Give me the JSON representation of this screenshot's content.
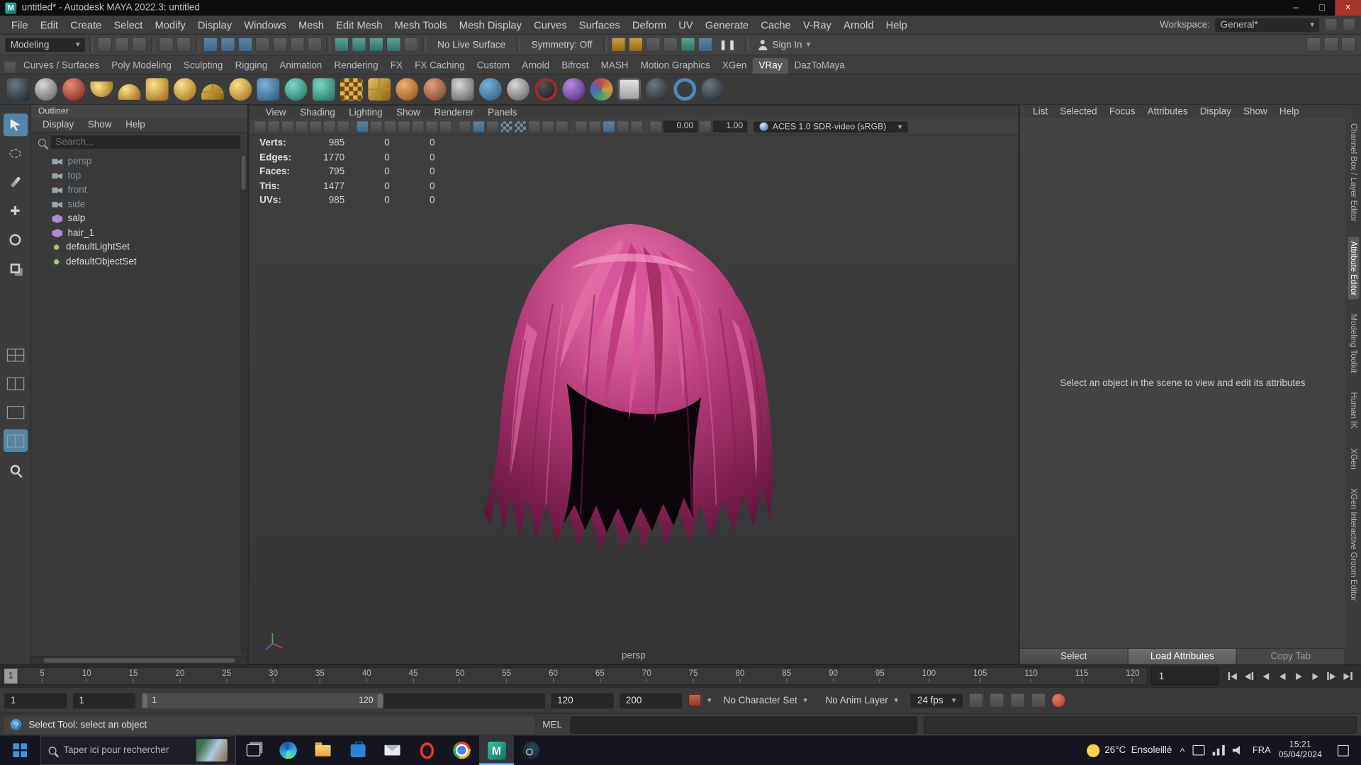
{
  "colors": {
    "accent_blue": "#5285a6",
    "hair_light": "#ef7ab2",
    "hair_mid": "#b53a78",
    "hair_dark": "#5c1038",
    "autokey_red": "#b03a2a",
    "taskbar_bg": "#15151f"
  },
  "window": {
    "title": "untitled* - Autodesk MAYA 2022.3: untitled"
  },
  "menu_bar": {
    "items": [
      "File",
      "Edit",
      "Create",
      "Select",
      "Modify",
      "Display",
      "Windows",
      "Mesh",
      "Edit Mesh",
      "Mesh Tools",
      "Mesh Display",
      "Curves",
      "Surfaces",
      "Deform",
      "UV",
      "Generate",
      "Cache",
      "V-Ray",
      "Arnold",
      "Help"
    ],
    "workspace_label": "Workspace:",
    "workspace_value": "General*"
  },
  "status_line": {
    "mode": "Modeling",
    "no_live_surface": "No Live Surface",
    "symmetry": "Symmetry: Off",
    "sign_in": "Sign In"
  },
  "shelf": {
    "tabs": [
      {
        "label": "Curves / Surfaces"
      },
      {
        "label": "Poly Modeling"
      },
      {
        "label": "Sculpting"
      },
      {
        "label": "Rigging"
      },
      {
        "label": "Animation"
      },
      {
        "label": "Rendering"
      },
      {
        "label": "FX"
      },
      {
        "label": "FX Caching"
      },
      {
        "label": "Custom"
      },
      {
        "label": "Arnold"
      },
      {
        "label": "Bifrost"
      },
      {
        "label": "MASH"
      },
      {
        "label": "Motion Graphics"
      },
      {
        "label": "XGen"
      },
      {
        "label": "VRay",
        "active": true
      },
      {
        "label": "DazToMaya"
      }
    ]
  },
  "outliner": {
    "title": "Outliner",
    "menus": [
      "Display",
      "Show",
      "Help"
    ],
    "search_placeholder": "Search...",
    "items": [
      {
        "label": "persp",
        "type": "camera"
      },
      {
        "label": "top",
        "type": "camera"
      },
      {
        "label": "front",
        "type": "camera"
      },
      {
        "label": "side",
        "type": "camera"
      },
      {
        "label": "salp",
        "type": "mesh"
      },
      {
        "label": "hair_1",
        "type": "mesh"
      },
      {
        "label": "defaultLightSet",
        "type": "set"
      },
      {
        "label": "defaultObjectSet",
        "type": "set"
      }
    ]
  },
  "viewport": {
    "menus": [
      "View",
      "Shading",
      "Lighting",
      "Show",
      "Renderer",
      "Panels"
    ],
    "hud_rows": [
      {
        "label": "Verts:",
        "total": "985",
        "c2": "0",
        "c3": "0"
      },
      {
        "label": "Edges:",
        "total": "1770",
        "c2": "0",
        "c3": "0"
      },
      {
        "label": "Faces:",
        "total": "795",
        "c2": "0",
        "c3": "0"
      },
      {
        "label": "Tris:",
        "total": "1477",
        "c2": "0",
        "c3": "0"
      },
      {
        "label": "UVs:",
        "total": "985",
        "c2": "0",
        "c3": "0"
      }
    ],
    "exposure": "0.00",
    "gamma": "1.00",
    "colorspace": "ACES 1.0 SDR-video (sRGB)",
    "camera_label": "persp"
  },
  "attribute_editor": {
    "menus": [
      "List",
      "Selected",
      "Focus",
      "Attributes",
      "Display",
      "Show",
      "Help"
    ],
    "empty_message": "Select an object in the scene to view and edit its attributes",
    "select_button": "Select",
    "load_button": "Load Attributes",
    "copy_button": "Copy Tab"
  },
  "side_tabs": [
    {
      "label": "Channel Box / Layer Editor"
    },
    {
      "label": "Attribute Editor",
      "active": true
    },
    {
      "label": "Modeling Toolkit"
    },
    {
      "label": "Human IK"
    },
    {
      "label": "XGen"
    },
    {
      "label": "XGen Interactive Groom Editor"
    }
  ],
  "timeline": {
    "ticks": [
      "5",
      "10",
      "15",
      "20",
      "25",
      "30",
      "35",
      "40",
      "45",
      "50",
      "55",
      "60",
      "65",
      "70",
      "75",
      "80",
      "85",
      "90",
      "95",
      "100",
      "105",
      "110",
      "115",
      "120"
    ],
    "current_marker": "1",
    "current_field": "1"
  },
  "range_slider": {
    "anim_start": "1",
    "playback_start": "1",
    "range_label_start": "1",
    "range_label_end": "120",
    "playback_end": "120",
    "anim_end": "200",
    "character_set": "No Character Set",
    "anim_layer": "No Anim Layer",
    "fps": "24 fps"
  },
  "command_line": {
    "help_text": "Select Tool: select an object",
    "mel_label": "MEL"
  },
  "taskbar": {
    "search_placeholder": "Taper ici pour rechercher",
    "weather_temp": "26°C",
    "weather_desc": "Ensoleillé",
    "language": "FRA",
    "time": "15:21",
    "date": "05/04/2024"
  }
}
